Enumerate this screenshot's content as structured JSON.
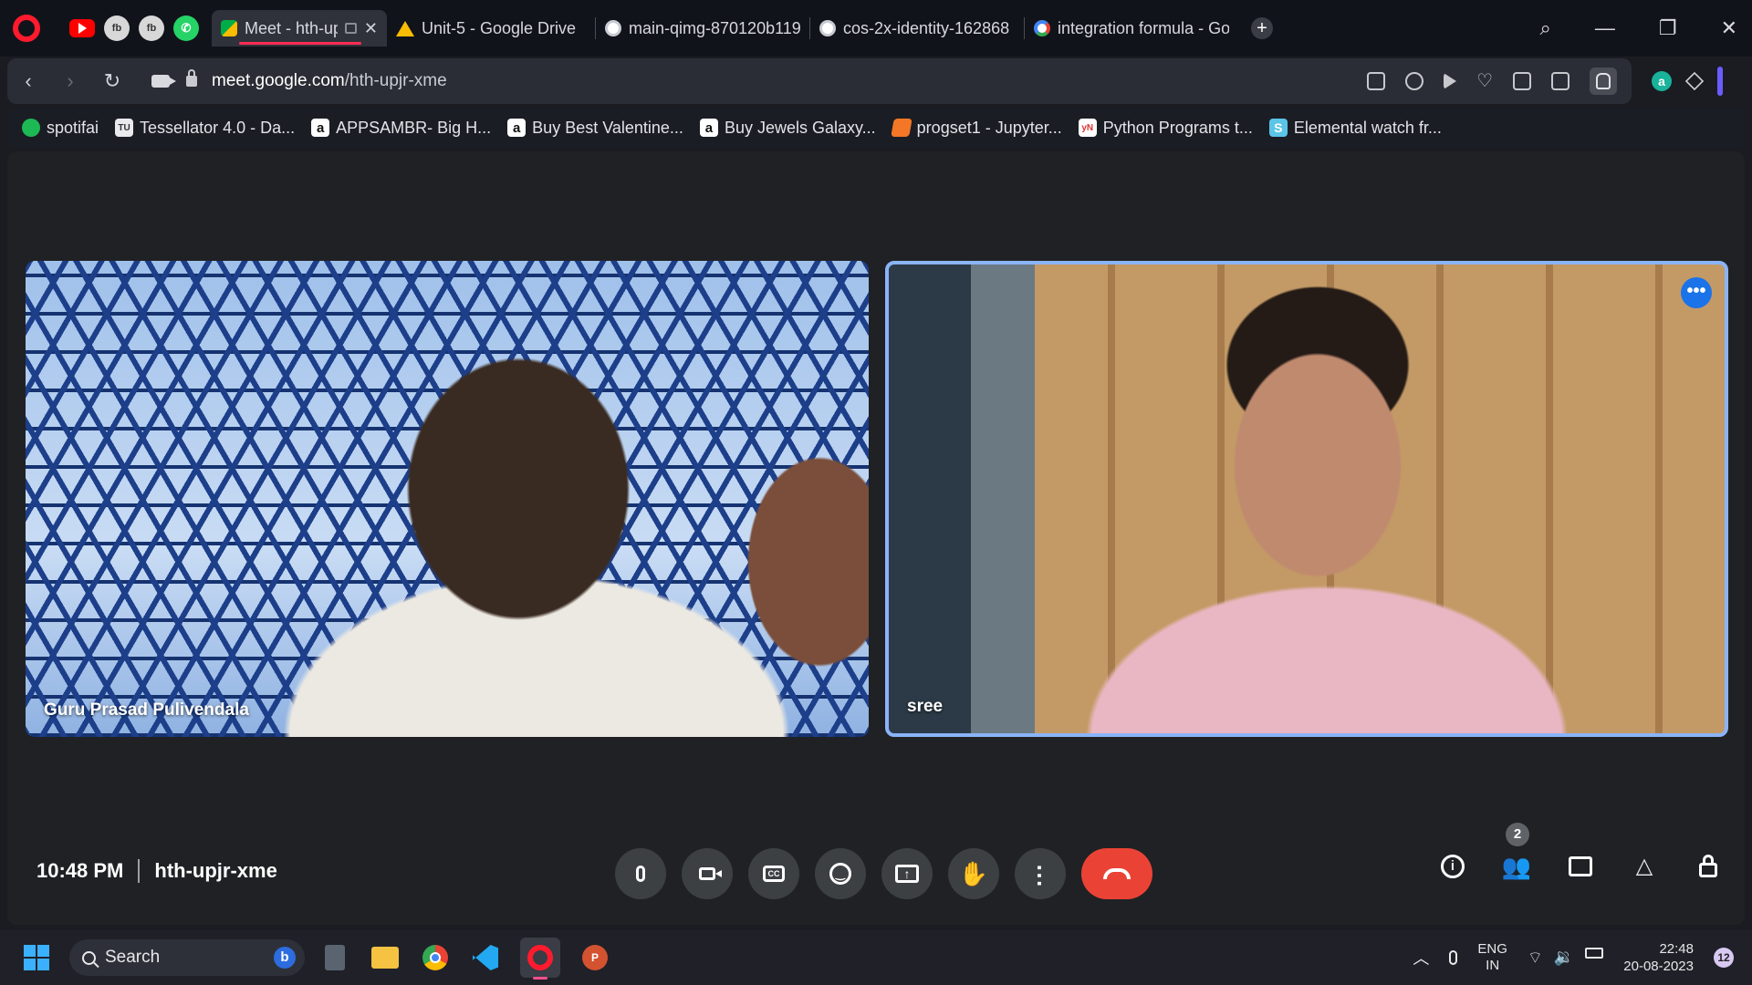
{
  "browser": {
    "pinned_tabs": [
      {
        "icon": "youtube-icon"
      },
      {
        "icon": "fb-profile-icon",
        "label": "fb"
      },
      {
        "icon": "fb-profile-icon",
        "label": "fb"
      },
      {
        "icon": "whatsapp-icon"
      }
    ],
    "tabs": [
      {
        "title": "Meet - hth-upjr-x",
        "favicon": "google-meet-icon",
        "active": true
      },
      {
        "title": "Unit-5 - Google Drive",
        "favicon": "google-drive-icon"
      },
      {
        "title": "main-qimg-870120b119",
        "favicon": "globe-icon"
      },
      {
        "title": "cos-2x-identity-162868",
        "favicon": "globe-icon"
      },
      {
        "title": "integration formula - Go",
        "favicon": "google-icon"
      }
    ],
    "new_tab_label": "+",
    "url_domain": "meet.google.com",
    "url_path": "/hth-upjr-xme",
    "extension_a_label": "a",
    "bookmarks": [
      {
        "label": "spotifai",
        "icon": "spotify-icon"
      },
      {
        "label": "Tessellator 4.0 - Da...",
        "icon": "tessellator-icon",
        "glyph": "TU"
      },
      {
        "label": "APPSAMBR- Big H...",
        "icon": "amazon-icon",
        "glyph": "a"
      },
      {
        "label": "Buy Best Valentine...",
        "icon": "amazon-icon",
        "glyph": "a"
      },
      {
        "label": "Buy Jewels Galaxy...",
        "icon": "amazon-icon",
        "glyph": "a"
      },
      {
        "label": "progset1 - Jupyter...",
        "icon": "jupyter-icon"
      },
      {
        "label": "Python Programs t...",
        "icon": "python-programs-icon",
        "glyph": "yN"
      },
      {
        "label": "Elemental watch fr...",
        "icon": "elemental-icon",
        "glyph": "S"
      }
    ]
  },
  "meet": {
    "participants": [
      {
        "name": "Guru Prasad Pulivendala"
      },
      {
        "name": "sree",
        "more_label": "•••"
      }
    ],
    "time": "10:48 PM",
    "meeting_code": "hth-upjr-xme",
    "people_count": "2",
    "cc_label": "CC",
    "info_label": "i"
  },
  "taskbar": {
    "search_placeholder": "Search",
    "bing_label": "b",
    "ppt_label": "P",
    "lang_primary": "ENG",
    "lang_secondary": "IN",
    "clock_time": "22:48",
    "clock_date": "20-08-2023",
    "notification_count": "12"
  }
}
